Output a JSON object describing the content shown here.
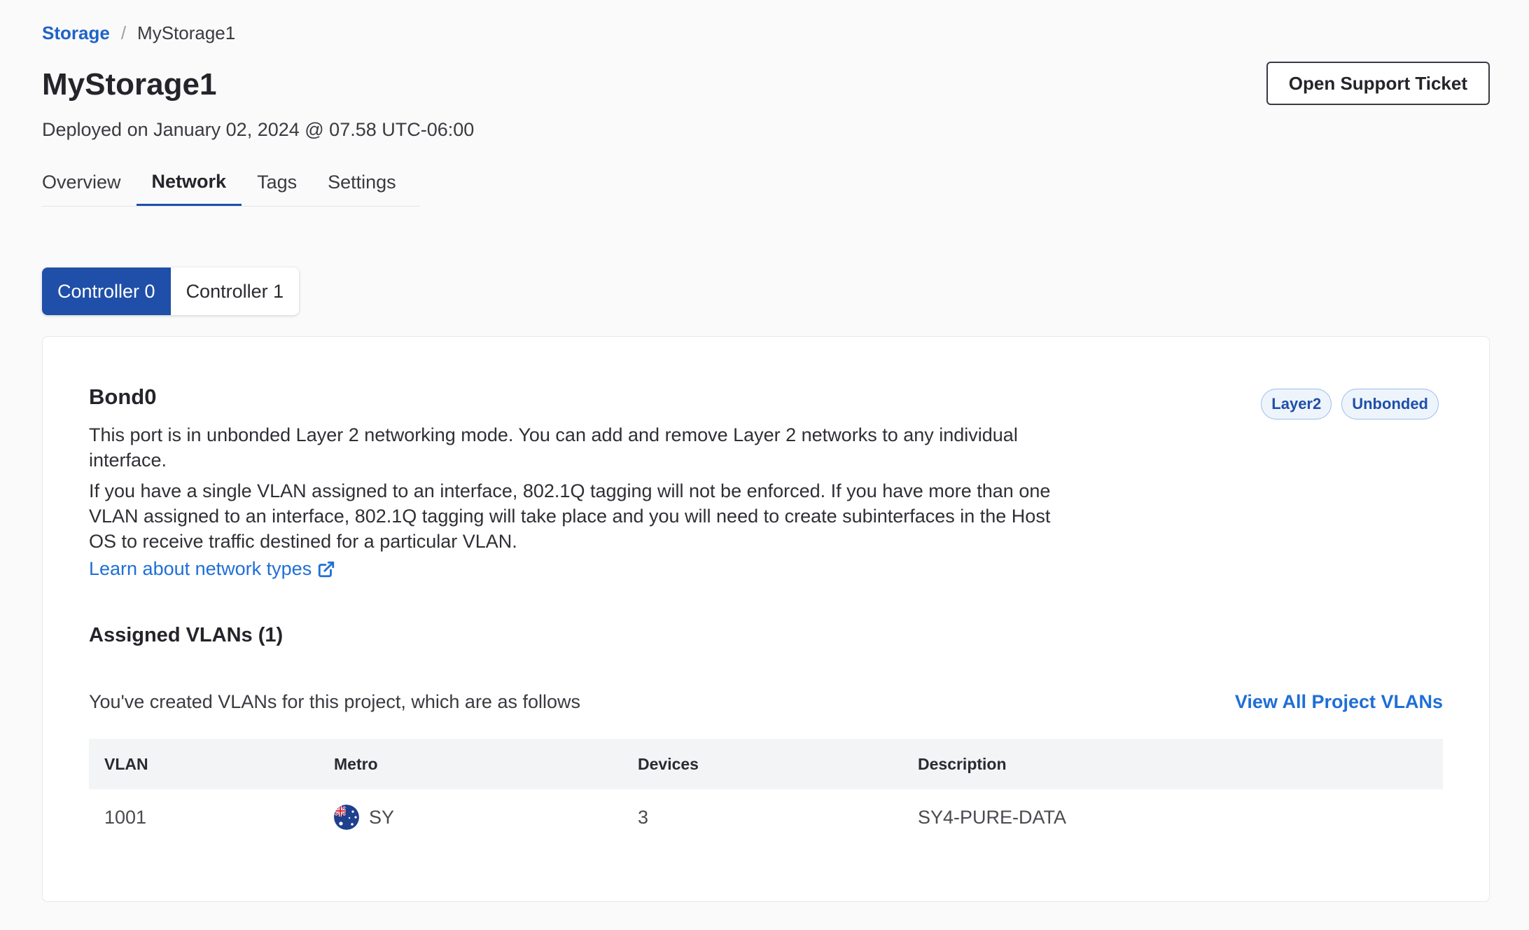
{
  "breadcrumb": {
    "root": "Storage",
    "separator": "/",
    "current": "MyStorage1"
  },
  "header": {
    "title": "MyStorage1",
    "deployed": "Deployed on January 02, 2024 @ 07.58 UTC-06:00",
    "support_button": "Open Support Ticket"
  },
  "tabs": [
    {
      "label": "Overview",
      "active": false
    },
    {
      "label": "Network",
      "active": true
    },
    {
      "label": "Tags",
      "active": false
    },
    {
      "label": "Settings",
      "active": false
    }
  ],
  "controllers": [
    {
      "label": "Controller 0",
      "active": true
    },
    {
      "label": "Controller 1",
      "active": false
    }
  ],
  "bond": {
    "title": "Bond0",
    "badges": [
      "Layer2",
      "Unbonded"
    ],
    "description_1": "This port is in unbonded Layer 2 networking mode. You can add and remove Layer 2 networks to any individual interface.",
    "description_2": "If you have a single VLAN assigned to an interface, 802.1Q tagging will not be enforced. If you have more than one VLAN assigned to an interface, 802.1Q tagging will take place and you will need to create subinterfaces in the Host OS to receive traffic destined for a particular VLAN.",
    "learn_link": "Learn about network types",
    "learn_icon": "external-link-icon"
  },
  "vlans": {
    "title": "Assigned VLANs (1)",
    "subtitle": "You've created VLANs for this project, which are as follows",
    "view_all": "View All Project VLANs",
    "columns": [
      "VLAN",
      "Metro",
      "Devices",
      "Description"
    ],
    "rows": [
      {
        "vlan": "1001",
        "metro": "SY",
        "metro_icon": "australia-flag-icon",
        "devices": "3",
        "description": "SY4-PURE-DATA"
      }
    ]
  },
  "colors": {
    "accent": "#1f4fa8",
    "link": "#1f6fd6",
    "badge_bg": "#eef4fc"
  }
}
